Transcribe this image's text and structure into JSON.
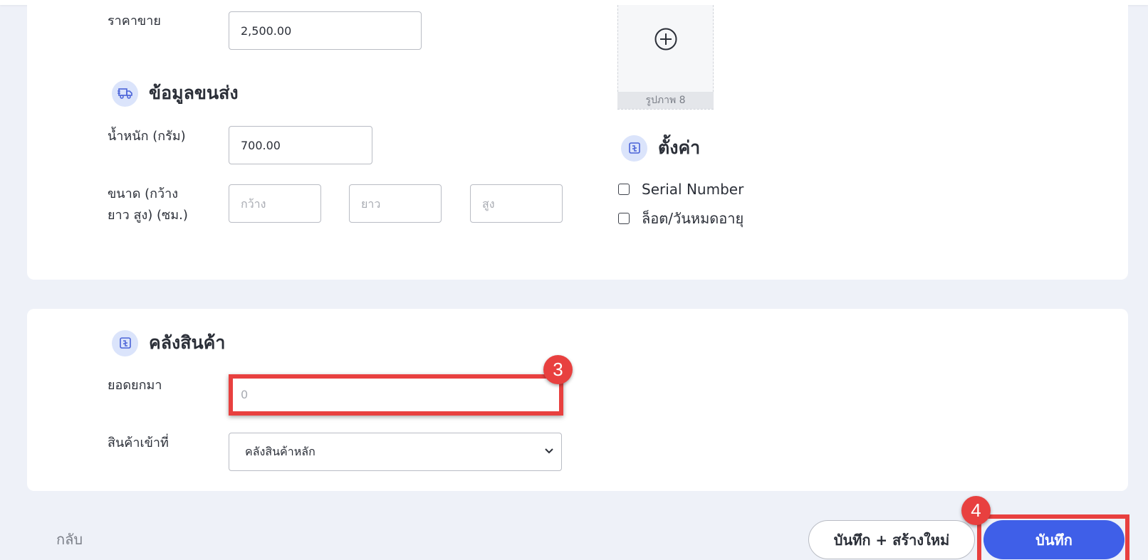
{
  "pricing": {
    "sale_price_label": "ราคาขาย",
    "sale_price_value": "2,500.00"
  },
  "images": {
    "slot_caption": "รูปภาพ 8",
    "add_icon": "plus-circle-icon"
  },
  "shipping": {
    "title": "ข้อมูลขนส่ง",
    "icon": "truck-icon",
    "weight_label": "น้ำหนัก (กรัม)",
    "weight_value": "700.00",
    "size_label_line1": "ขนาด (กว้าง",
    "size_label_line2": "ยาว สูง) (ซม.)",
    "width_placeholder": "กว้าง",
    "length_placeholder": "ยาว",
    "height_placeholder": "สูง"
  },
  "settings": {
    "title": "ตั้งค่า",
    "icon": "settings-icon",
    "options": [
      {
        "label": "Serial Number",
        "checked": false
      },
      {
        "label": "ล็อต/วันหมดอายุ",
        "checked": false
      }
    ]
  },
  "warehouse": {
    "title": "คลังสินค้า",
    "icon": "warehouse-icon",
    "opening_balance_label": "ยอดยกมา",
    "opening_balance_placeholder": "0",
    "receive_into_label": "สินค้าเข้าที่",
    "receive_into_value": "คลังสินค้าหลัก"
  },
  "annotations": {
    "step_3": "3",
    "step_4": "4",
    "highlight_color": "#e8403f"
  },
  "footer": {
    "back_label": "กลับ",
    "save_and_new_label": "บันทึก + สร้างใหม่",
    "save_label": "บันทึก"
  },
  "colors": {
    "primary": "#3f5fe8",
    "background": "#eef1f8",
    "icon_bg": "#dbe4fb"
  }
}
